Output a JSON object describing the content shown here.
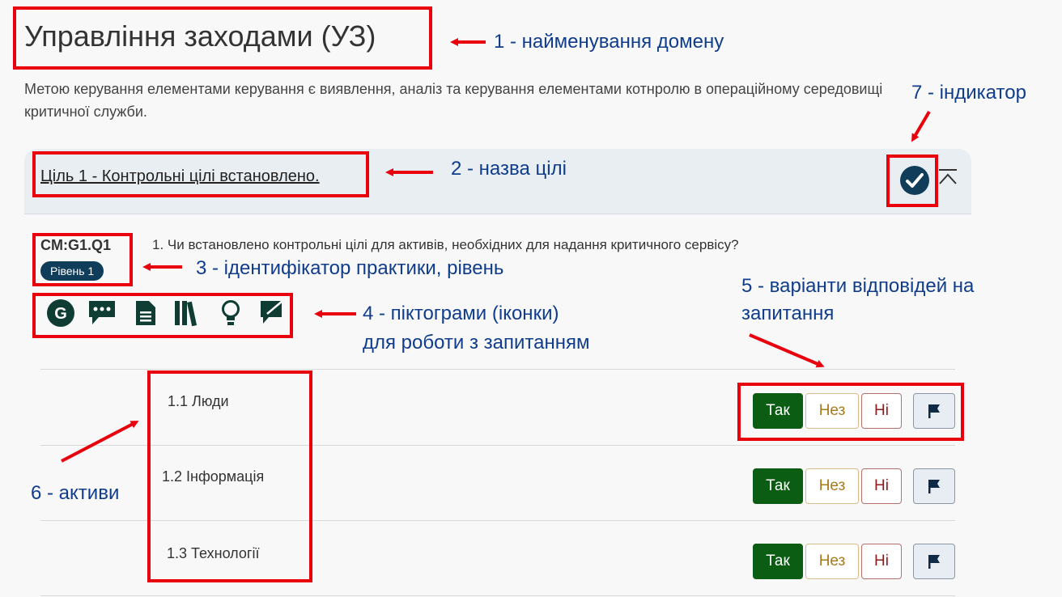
{
  "page": {
    "title": "Управління заходами (УЗ)",
    "description": "Метою керування елементами керування є виявлення, аналіз та керування елементами котнролю в операційному середовищі критичної служби."
  },
  "goal": {
    "title": "Ціль 1 - Контрольні цілі встановлено.",
    "indicator_icon": "check-circle-icon",
    "collapse_icon": "chevron-up-icon"
  },
  "practice": {
    "id": "CM:G1.Q1",
    "level": "Рівень 1",
    "question": "1. Чи встановлено контрольні цілі для активів, необхідних для надання критичного сервісу?",
    "tool_icons": [
      "glossary-icon",
      "comments-icon",
      "document-icon",
      "references-icon",
      "lightbulb-icon",
      "observations-icon"
    ]
  },
  "answer_labels": {
    "yes": "Так",
    "partial": "Нез",
    "no": "Ні",
    "flag_icon": "flag-icon"
  },
  "assets": [
    {
      "label": "1.1 Люди"
    },
    {
      "label": "1.2 Інформація"
    },
    {
      "label": "1.3 Технології"
    }
  ],
  "annotations": [
    {
      "id": 1,
      "text": "1 - найменування домену"
    },
    {
      "id": 2,
      "text": "2 - назва цілі"
    },
    {
      "id": 3,
      "text": "3 - ідентифікатор практики, рівень"
    },
    {
      "id": 4,
      "text": "4 - піктограми (іконки)",
      "text2": "для роботи з запитанням"
    },
    {
      "id": 5,
      "text": "5 - варіанти відповідей на",
      "text2": "запитання"
    },
    {
      "id": 6,
      "text": "6 - активи"
    },
    {
      "id": 7,
      "text": "7 - індикатор"
    }
  ],
  "colors": {
    "annotation_red": "#e8000d",
    "annotation_text": "#0f3d8c",
    "brand_dark": "#0f3d5a",
    "yes_green": "#0b5d13",
    "partial_gold": "#a77a1a",
    "no_red": "#8e1a1a",
    "goal_bar": "#e9eef2"
  }
}
